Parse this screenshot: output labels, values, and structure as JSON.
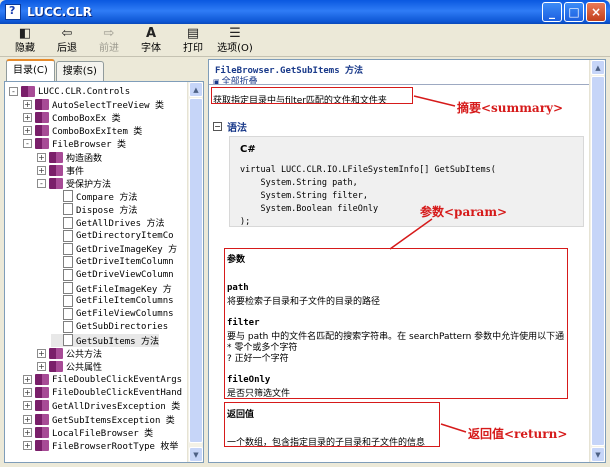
{
  "window": {
    "title": "LUCC.CLR"
  },
  "toolbar": {
    "buttons": [
      {
        "label": "隐藏",
        "icon": "hide-icon"
      },
      {
        "label": "后退",
        "icon": "back-icon"
      },
      {
        "label": "前进",
        "icon": "forward-icon",
        "disabled": true
      },
      {
        "label": "字体",
        "icon": "font-icon"
      },
      {
        "label": "打印",
        "icon": "print-icon"
      },
      {
        "label": "选项(O)",
        "icon": "options-icon"
      }
    ]
  },
  "tabs": [
    {
      "label": "目录(C)",
      "active": true
    },
    {
      "label": "搜索(S)",
      "active": false
    }
  ],
  "tree": {
    "items": [
      {
        "label": "LUCC.CLR.Controls",
        "indent": 0,
        "expander": "-",
        "icon": "book"
      },
      {
        "label": "AutoSelectTreeView 类",
        "indent": 1,
        "expander": "+",
        "icon": "book"
      },
      {
        "label": "ComboBoxEx 类",
        "indent": 1,
        "expander": "+",
        "icon": "book"
      },
      {
        "label": "ComboBoxExItem 类",
        "indent": 1,
        "expander": "+",
        "icon": "book"
      },
      {
        "label": "FileBrowser 类",
        "indent": 1,
        "expander": "-",
        "icon": "book"
      },
      {
        "label": "构造函数",
        "indent": 2,
        "expander": "+",
        "icon": "book"
      },
      {
        "label": "事件",
        "indent": 2,
        "expander": "+",
        "icon": "book"
      },
      {
        "label": "受保护方法",
        "indent": 2,
        "expander": "-",
        "icon": "book"
      },
      {
        "label": "Compare 方法",
        "indent": 3,
        "expander": "",
        "icon": "page"
      },
      {
        "label": "Dispose 方法",
        "indent": 3,
        "expander": "",
        "icon": "page"
      },
      {
        "label": "GetAllDrives 方法",
        "indent": 3,
        "expander": "",
        "icon": "page"
      },
      {
        "label": "GetDirectoryItemCo",
        "indent": 3,
        "expander": "",
        "icon": "page"
      },
      {
        "label": "GetDriveImageKey 方",
        "indent": 3,
        "expander": "",
        "icon": "page"
      },
      {
        "label": "GetDriveItemColumn",
        "indent": 3,
        "expander": "",
        "icon": "page"
      },
      {
        "label": "GetDriveViewColumn",
        "indent": 3,
        "expander": "",
        "icon": "page"
      },
      {
        "label": "GetFileImageKey 方",
        "indent": 3,
        "expander": "",
        "icon": "page"
      },
      {
        "label": "GetFileItemColumns",
        "indent": 3,
        "expander": "",
        "icon": "page"
      },
      {
        "label": "GetFileViewColumns",
        "indent": 3,
        "expander": "",
        "icon": "page"
      },
      {
        "label": "GetSubDirectories",
        "indent": 3,
        "expander": "",
        "icon": "page"
      },
      {
        "label": "GetSubItems 方法",
        "indent": 3,
        "expander": "",
        "icon": "page",
        "selected": true
      },
      {
        "label": "公共方法",
        "indent": 2,
        "expander": "+",
        "icon": "book"
      },
      {
        "label": "公共属性",
        "indent": 2,
        "expander": "+",
        "icon": "book"
      },
      {
        "label": "FileDoubleClickEventArgs",
        "indent": 1,
        "expander": "+",
        "icon": "book"
      },
      {
        "label": "FileDoubleClickEventHand",
        "indent": 1,
        "expander": "+",
        "icon": "book"
      },
      {
        "label": "GetAllDrivesException 类",
        "indent": 1,
        "expander": "+",
        "icon": "book"
      },
      {
        "label": "GetSubItemsException 类",
        "indent": 1,
        "expander": "+",
        "icon": "book"
      },
      {
        "label": "LocalFileBrowser 类",
        "indent": 1,
        "expander": "+",
        "icon": "book"
      },
      {
        "label": "FileBrowserRootType 枚举",
        "indent": 1,
        "expander": "+",
        "icon": "book"
      }
    ]
  },
  "content": {
    "title": "FileBrowser.GetSubItems 方法",
    "collapse_all": "全部折叠",
    "summary": "获取指定目录中与filter匹配的文件和文件夹",
    "syntax_title": "语法",
    "code_lang": "C#",
    "code_lines": [
      "virtual LUCC.CLR.IO.LFileSystemInfo[] GetSubItems(",
      "    System.String path,",
      "    System.String filter,",
      "    System.Boolean fileOnly",
      ");"
    ],
    "params_title": "参数",
    "params": [
      {
        "name": "path",
        "desc": "将要检索子目录和子文件的目录的路径"
      },
      {
        "name": "filter",
        "desc": "要与 path 中的文件名匹配的搜索字符串。在 searchPattern 参数中允许使用以下通",
        "extra": [
          "* 零个或多个字符",
          "? 正好一个字符"
        ]
      },
      {
        "name": "fileOnly",
        "desc": "是否只筛选文件"
      }
    ],
    "returns_title": "返回值",
    "returns_desc": "一个数组，包含指定目录的子目录和子文件的信息"
  },
  "annotations": {
    "summary": "摘要<summary>",
    "param": "参数<param>",
    "return": "返回值<return>",
    "color": "#d61a1a"
  }
}
